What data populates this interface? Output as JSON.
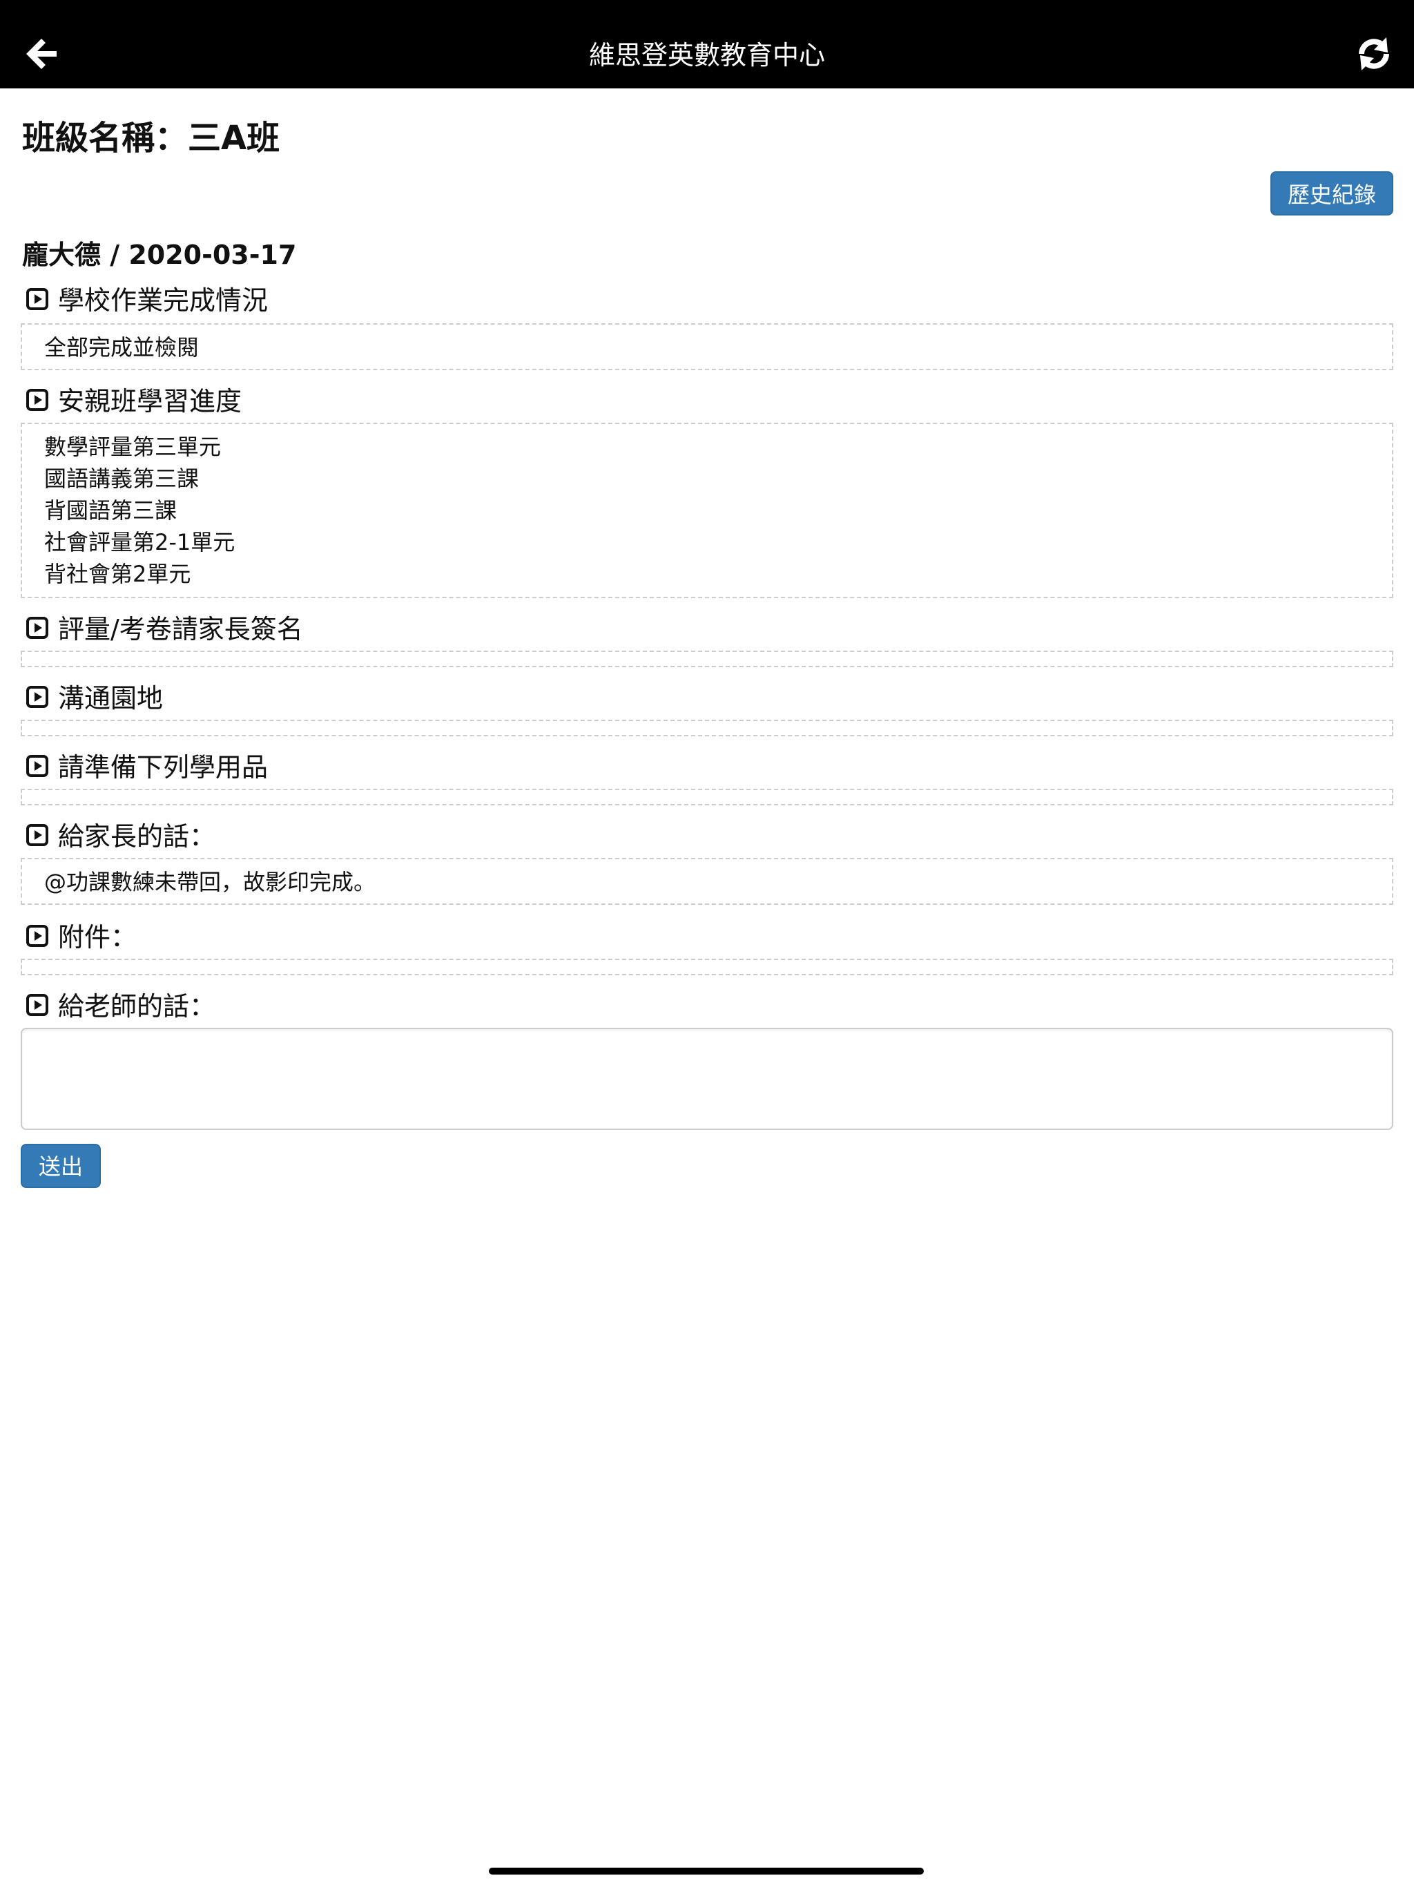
{
  "header": {
    "title": "維思登英數教育中心",
    "back_icon": "arrow-left-icon",
    "refresh_icon": "refresh-icon"
  },
  "page": {
    "class_name": "班級名稱：三A班",
    "history_button": "歷史紀錄",
    "student_date": "龐大德 / 2020-03-17"
  },
  "sections": {
    "school_homework": {
      "title": "學校作業完成情況",
      "lines": [
        "全部完成並檢閱"
      ]
    },
    "progress": {
      "title": "安親班學習進度",
      "lines": [
        "數學評量第三單元",
        "國語講義第三課",
        "背國語第三課",
        "社會評量第2-1單元",
        "背社會第2單元"
      ]
    },
    "signature": {
      "title": "評量/考卷請家長簽名",
      "lines": []
    },
    "communication": {
      "title": "溝通園地",
      "lines": []
    },
    "supplies": {
      "title": "請準備下列學用品",
      "lines": []
    },
    "to_parents": {
      "title": "給家長的話：",
      "lines": [
        "@功課數練未帶回，故影印完成。"
      ]
    },
    "attachments": {
      "title": "附件：",
      "lines": []
    },
    "to_teacher": {
      "title": "給老師的話：",
      "value": ""
    }
  },
  "submit_button": "送出",
  "colors": {
    "primary": "#337ab7",
    "topbar": "#000000"
  },
  "section_icon": "play-square-icon"
}
